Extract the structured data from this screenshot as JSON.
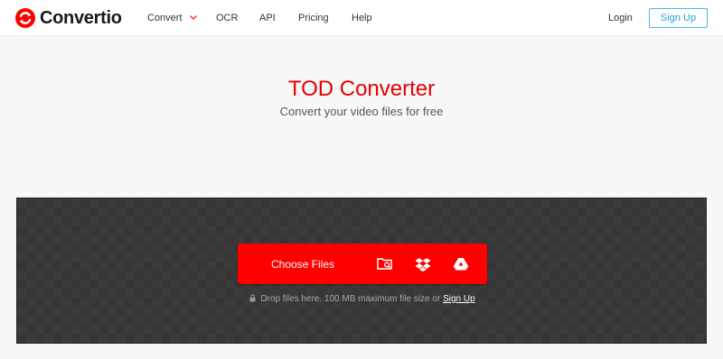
{
  "brand": {
    "name": "Convertio",
    "logo_icon": "convertio-logo-icon",
    "accent_color": "#ff0000"
  },
  "nav": {
    "convert": "Convert",
    "ocr": "OCR",
    "api": "API",
    "pricing": "Pricing",
    "help": "Help",
    "login": "Login",
    "signup": "Sign Up"
  },
  "hero": {
    "title": "TOD Converter",
    "subtitle": "Convert your video files for free"
  },
  "upload": {
    "choose_files": "Choose Files",
    "icons": [
      "folder-search-icon",
      "dropbox-icon",
      "google-drive-icon"
    ],
    "drop_note": "Drop files here. 100 MB maximum file size or",
    "drop_signup": "Sign Up"
  }
}
